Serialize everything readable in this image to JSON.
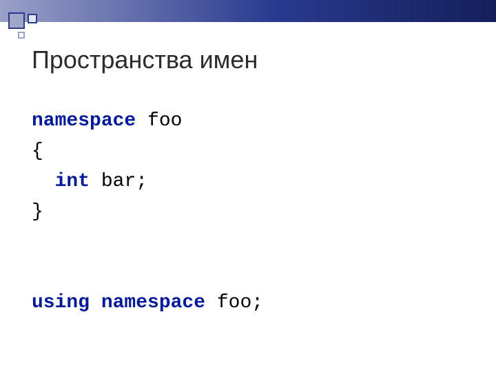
{
  "title": "Пространства имен",
  "code": {
    "l1": {
      "kw": "namespace",
      "sp": " ",
      "id": "foo"
    },
    "l2": "{",
    "l3": {
      "indent": "  ",
      "kw": "int",
      "sp": " ",
      "id": "bar",
      "semi": ";"
    },
    "l4": "}",
    "l5": "",
    "l6": "",
    "l7": {
      "kw": "using namespace",
      "sp": " ",
      "id": "foo",
      "semi": ";"
    }
  }
}
